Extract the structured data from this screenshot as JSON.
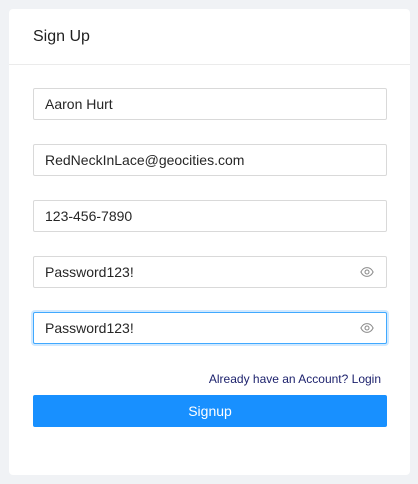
{
  "card": {
    "title": "Sign Up"
  },
  "form": {
    "name_value": "Aaron Hurt",
    "email_value": "RedNeckInLace@geocities.com",
    "phone_value": "123-456-7890",
    "password_value": "Password123!",
    "confirm_password_value": "Password123!"
  },
  "login_link": "Already have an Account? Login",
  "signup_label": "Signup",
  "icons": {
    "password_toggle": "eye-icon",
    "confirm_toggle": "eye-icon"
  },
  "colors": {
    "primary": "#1890ff",
    "focus_border": "#40a9ff",
    "link": "#1a1f6b"
  }
}
